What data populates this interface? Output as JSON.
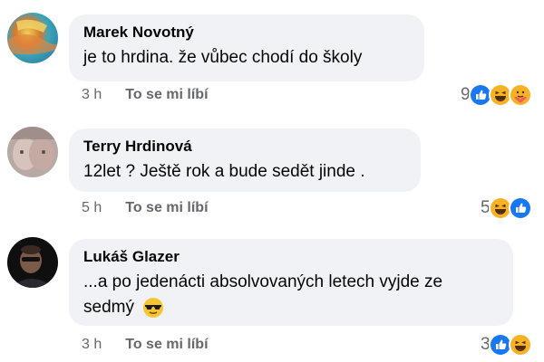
{
  "comments": [
    {
      "author": "Marek Novotný",
      "text": "je to hrdina. že vůbec chodí do školy",
      "time": "3 h",
      "like_label": "To se mi líbí",
      "reaction_count": "9",
      "reactions": [
        "like-icon",
        "haha-icon",
        "care-icon"
      ]
    },
    {
      "author": "Terry Hrdinová",
      "text": "12let ? Ještě rok a bude sedět jinde .",
      "time": "5 h",
      "like_label": "To se mi líbí",
      "reaction_count": "5",
      "reactions": [
        "haha-icon",
        "like-icon"
      ]
    },
    {
      "author": "Lukáš Glazer",
      "text_line1": "...a po jedenácti absolvovaných letech vyjde ze",
      "text_line2": "sedmý",
      "text_emoji": "cool-sunglasses-emoji",
      "time": "3 h",
      "like_label": "To se mi líbí",
      "reaction_count": "3",
      "reactions": [
        "like-icon",
        "haha-icon"
      ]
    }
  ],
  "colors": {
    "bubble": "#f0f2f5",
    "meta_text": "#65676b",
    "like_blue": "#1877f2",
    "haha_yellow": "#f7b125"
  }
}
